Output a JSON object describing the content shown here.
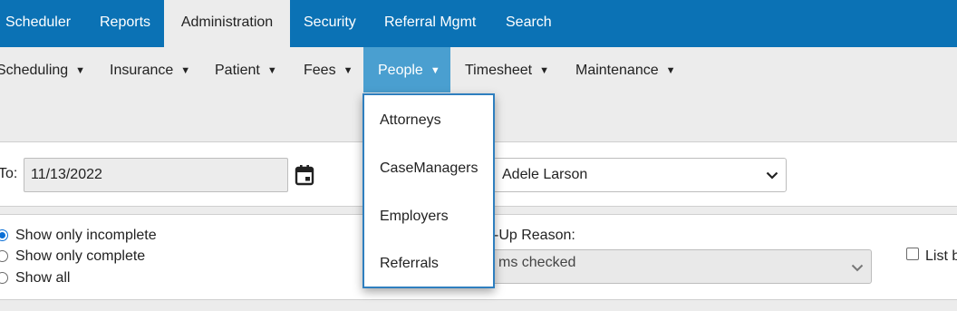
{
  "topnav": {
    "tabs": [
      {
        "label": "Scheduler"
      },
      {
        "label": "Reports"
      },
      {
        "label": "Administration"
      },
      {
        "label": "Security"
      },
      {
        "label": "Referral Mgmt"
      },
      {
        "label": "Search"
      }
    ],
    "active_tab": "Administration"
  },
  "subnav": {
    "items": [
      {
        "label": "Scheduling"
      },
      {
        "label": "Insurance"
      },
      {
        "label": "Patient"
      },
      {
        "label": "Fees"
      },
      {
        "label": "People"
      },
      {
        "label": "Timesheet"
      },
      {
        "label": "Maintenance"
      }
    ],
    "active_item": "People"
  },
  "people_menu": {
    "options": [
      {
        "label": "Attorneys"
      },
      {
        "label": "CaseManagers"
      },
      {
        "label": "Employers"
      },
      {
        "label": "Referrals"
      }
    ]
  },
  "filters": {
    "to_label": "To:",
    "to_date": "11/13/2022",
    "person_select": "Adele Larson",
    "status_options": [
      {
        "label": "Show only incomplete",
        "checked": true
      },
      {
        "label": "Show only complete",
        "checked": false
      },
      {
        "label": "Show all",
        "checked": false
      }
    ],
    "reason_label": "-Up Reason:",
    "reason_select": "ms checked",
    "list_checkbox_label": "List b"
  },
  "colors": {
    "topnav_bg": "#0b72b5",
    "active_subnav_bg": "#4a9fd0",
    "dropdown_border": "#2f7fbf"
  }
}
